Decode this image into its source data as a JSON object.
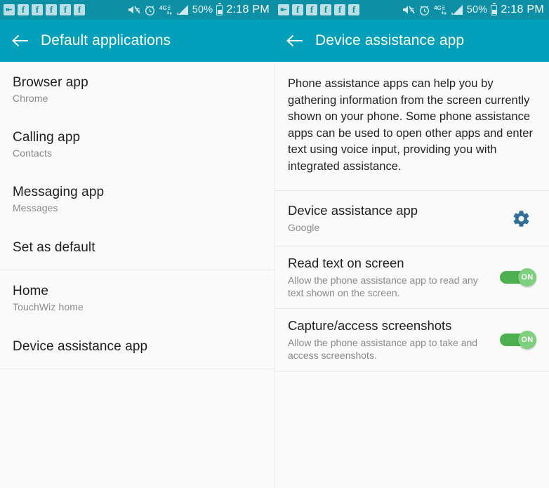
{
  "colors": {
    "statusbar_bg": "#0d8fa5",
    "actionbar_bg": "#00a0bb",
    "page_bg": "#fafafa",
    "gear_accent": "#326e96",
    "toggle_track_on": "#4cb050",
    "toggle_knob_on": "#7ed07f",
    "divider": "#e6e6e6"
  },
  "statusbar": {
    "left_icons": [
      {
        "name": "app-install-icon",
        "glyph": "←+"
      },
      {
        "name": "facebook-notification-icon",
        "glyph": "f"
      },
      {
        "name": "facebook-notification-icon",
        "glyph": "f"
      },
      {
        "name": "facebook-notification-icon",
        "glyph": "f"
      },
      {
        "name": "facebook-notification-icon",
        "glyph": "f"
      },
      {
        "name": "facebook-notification-icon",
        "glyph": "f"
      }
    ],
    "right_icons": [
      {
        "name": "sound-mute-icon"
      },
      {
        "name": "alarm-clock-icon"
      },
      {
        "name": "network-4g-lte-icon",
        "label": "4G"
      },
      {
        "name": "signal-bars-icon"
      }
    ],
    "battery_percent": "50%",
    "time": "2:18 PM"
  },
  "left_screen": {
    "back_icon": "arrow-left-icon",
    "title": "Default applications",
    "rows": [
      {
        "title": "Browser app",
        "subtitle": "Chrome"
      },
      {
        "title": "Calling app",
        "subtitle": "Contacts"
      },
      {
        "title": "Messaging app",
        "subtitle": "Messages"
      },
      {
        "title": "Set as default",
        "subtitle": ""
      },
      {
        "title": "Home",
        "subtitle": "TouchWiz home"
      },
      {
        "title": "Device assistance app",
        "subtitle": ""
      }
    ]
  },
  "right_screen": {
    "back_icon": "arrow-left-icon",
    "title": "Device assistance app",
    "description": "Phone assistance apps can help you by gathering information from the screen currently shown on your phone. Some phone assistance apps can be used to open other apps and enter text using voice input, providing you with integrated assistance.",
    "rows": [
      {
        "title": "Device assistance app",
        "subtitle": "Google",
        "control": "gear",
        "gear_icon": "gear-icon"
      },
      {
        "title": "Read text on screen",
        "subtitle": "Allow the phone assistance app to read any text shown on the screen.",
        "control": "toggle",
        "toggle_state": "ON"
      },
      {
        "title": "Capture/access screenshots",
        "subtitle": "Allow the phone assistance app to take and access screenshots.",
        "control": "toggle",
        "toggle_state": "ON"
      }
    ]
  }
}
